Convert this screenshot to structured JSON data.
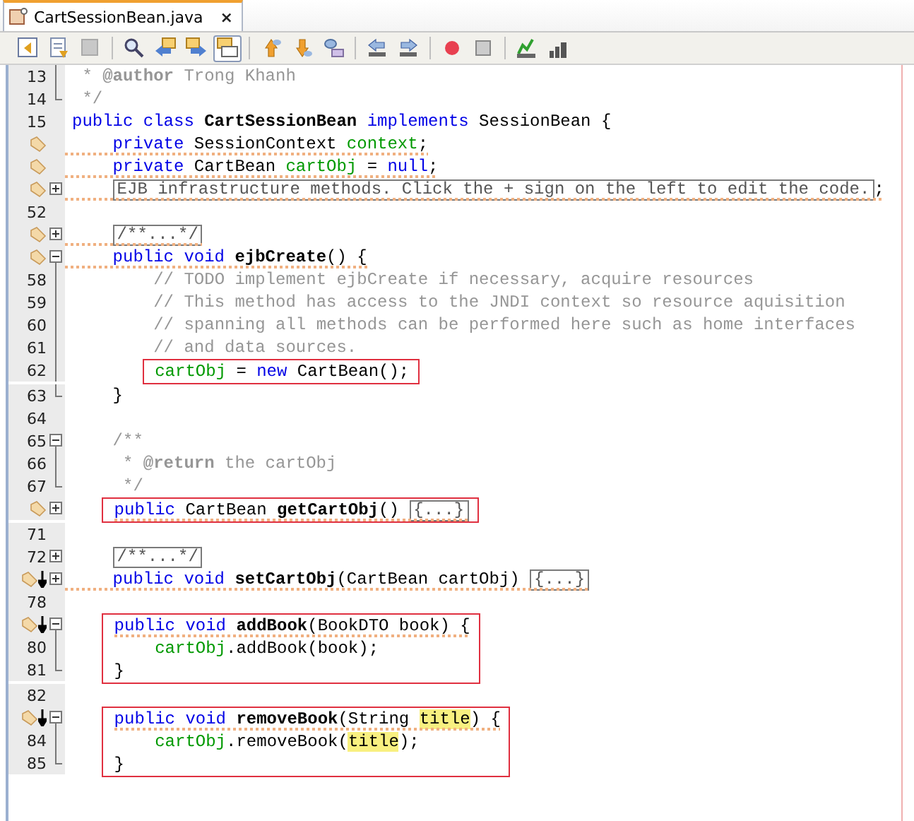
{
  "tab": {
    "title": "CartSessionBean.java",
    "close": "×",
    "selected": true
  },
  "toolbar": [
    {
      "kind": "history",
      "selected": false
    },
    {
      "kind": "doc-menu",
      "selected": false
    },
    {
      "kind": "disabled-menu",
      "selected": false
    },
    {
      "kind": "sep"
    },
    {
      "kind": "find",
      "selected": false
    },
    {
      "kind": "find-prev",
      "selected": false
    },
    {
      "kind": "find-next",
      "selected": false
    },
    {
      "kind": "highlight",
      "selected": true
    },
    {
      "kind": "sep"
    },
    {
      "kind": "up",
      "selected": false
    },
    {
      "kind": "down",
      "selected": false
    },
    {
      "kind": "toggle",
      "selected": false
    },
    {
      "kind": "sep"
    },
    {
      "kind": "shift-left",
      "selected": false
    },
    {
      "kind": "shift-right",
      "selected": false
    },
    {
      "kind": "sep"
    },
    {
      "kind": "record",
      "selected": false
    },
    {
      "kind": "stop",
      "selected": false
    },
    {
      "kind": "sep"
    },
    {
      "kind": "check",
      "selected": false
    },
    {
      "kind": "bars",
      "selected": false
    }
  ],
  "rows": [
    {
      "kind": "doc",
      "number": "13",
      "fold": {
        "kind": "inner"
      },
      "warning": false,
      "tokens": [
        {
          "text": "*",
          "kind": "comment"
        },
        {
          "text": "@author",
          "kind": "tag"
        },
        {
          "text": "Trong Khanh",
          "kind": "comment"
        }
      ]
    },
    {
      "kind": "doc",
      "number": "14",
      "fold": {
        "kind": "end"
      },
      "warning": false,
      "tokens": [
        {
          "text": "*/",
          "kind": "comment"
        }
      ]
    },
    {
      "kind": "code",
      "number": "15",
      "warning": false,
      "tokens": [
        {
          "text": "public class",
          "kind": "kw"
        },
        {
          "text": "CartSessionBean",
          "kind": "name"
        },
        {
          "text": "implements",
          "kind": "kw"
        },
        {
          "text": "SessionBean {",
          "kind": "plain"
        }
      ],
      "children": [
        {
          "kind": "code",
          "marks": [
            {
              "kind": "tag"
            }
          ],
          "warning": true,
          "tokens": [
            {
              "text": "private",
              "kind": "kw"
            },
            {
              "text": "SessionContext",
              "kind": "plain"
            },
            {
              "text": "context",
              "kind": "field"
            },
            {
              "text": ";",
              "kind": "punct"
            }
          ]
        },
        {
          "kind": "code",
          "marks": [
            {
              "kind": "tag"
            }
          ],
          "warning": true,
          "tokens": [
            {
              "text": "private",
              "kind": "kw"
            },
            {
              "text": "CartBean",
              "kind": "plain"
            },
            {
              "text": "cartObj",
              "kind": "field"
            },
            {
              "text": "=",
              "kind": "plain"
            },
            {
              "text": "null",
              "kind": "kw"
            },
            {
              "text": ";",
              "kind": "punct"
            }
          ]
        },
        {
          "kind": "code",
          "marks": [
            {
              "kind": "tag"
            }
          ],
          "fold": {
            "kind": "plus"
          },
          "warning": true,
          "tokens": [
            {
              "text": "EJB infrastructure methods. Click the + sign on the left to edit the code.",
              "kind": "folded"
            },
            {
              "text": ";",
              "kind": "punct"
            }
          ]
        },
        {
          "kind": "code",
          "number": "52",
          "warning": false
        },
        {
          "kind": "code",
          "marks": [
            {
              "kind": "tag"
            }
          ],
          "fold": {
            "kind": "plus"
          },
          "warning": true,
          "tokens": [
            {
              "text": "/**...*/",
              "kind": "folded"
            }
          ]
        },
        {
          "kind": "code",
          "marks": [
            {
              "kind": "tag"
            }
          ],
          "fold": {
            "kind": "minus"
          },
          "warning": true,
          "tokens": [
            {
              "text": "public void",
              "kind": "kw"
            },
            {
              "text": "ejbCreate",
              "kind": "name"
            },
            {
              "text": "() {",
              "kind": "punct"
            }
          ],
          "children": [
            {
              "kind": "code",
              "number": "58",
              "fold": {
                "kind": "inner"
              },
              "warning": false,
              "tokens": [
                {
                  "text": "// TODO implement ejbCreate if necessary, acquire resources",
                  "kind": "comment"
                }
              ]
            },
            {
              "kind": "code",
              "number": "59",
              "fold": {
                "kind": "inner"
              },
              "warning": false,
              "tokens": [
                {
                  "text": "// This method has access to the JNDI context so resource aquisition",
                  "kind": "comment"
                }
              ]
            },
            {
              "kind": "code",
              "number": "60",
              "fold": {
                "kind": "inner"
              },
              "warning": false,
              "tokens": [
                {
                  "text": "// spanning all methods can be performed here such as home interfaces",
                  "kind": "comment"
                }
              ]
            },
            {
              "kind": "code",
              "number": "61",
              "fold": {
                "kind": "inner"
              },
              "warning": false,
              "tokens": [
                {
                  "text": "// and data sources.",
                  "kind": "comment"
                }
              ]
            },
            {
              "kind": "boxed",
              "lines": [
                {
                  "number": "62",
                  "fold": {
                    "kind": "inner"
                  },
                  "warning": false,
                  "tokens": [
                    {
                      "text": "cartObj",
                      "kind": "field"
                    },
                    {
                      "text": "=",
                      "kind": "plain"
                    },
                    {
                      "text": "new",
                      "kind": "kw"
                    },
                    {
                      "text": "CartBean();",
                      "kind": "plain"
                    }
                  ]
                }
              ]
            }
          ]
        },
        {
          "kind": "code",
          "number": "63",
          "fold": {
            "kind": "end"
          },
          "warning": false,
          "tokens": [
            {
              "text": "}",
              "kind": "punct"
            }
          ]
        },
        {
          "kind": "code",
          "number": "64",
          "warning": false
        },
        {
          "kind": "code",
          "number": "65",
          "fold": {
            "kind": "minus"
          },
          "warning": false,
          "tokens": [
            {
              "text": "/**",
              "kind": "comment"
            }
          ]
        },
        {
          "kind": "doc",
          "number": "66",
          "fold": {
            "kind": "inner"
          },
          "warning": false,
          "tokens": [
            {
              "text": "*",
              "kind": "comment"
            },
            {
              "text": "@return",
              "kind": "tag"
            },
            {
              "text": "the cartObj",
              "kind": "comment"
            }
          ]
        },
        {
          "kind": "doc",
          "number": "67",
          "fold": {
            "kind": "end"
          },
          "warning": false,
          "tokens": [
            {
              "text": "*/",
              "kind": "comment"
            }
          ]
        },
        {
          "kind": "boxed",
          "lines": [
            {
              "marks": [
                {
                  "kind": "tag"
                }
              ],
              "fold": {
                "kind": "plus"
              },
              "warning": true,
              "tokens": [
                {
                  "text": "public",
                  "kind": "kw"
                },
                {
                  "text": "CartBean",
                  "kind": "plain"
                },
                {
                  "text": "getCartObj",
                  "kind": "name"
                },
                {
                  "text": "()",
                  "kind": "punct"
                },
                {
                  "text": "{...}",
                  "kind": "folded"
                }
              ]
            }
          ]
        },
        {
          "kind": "code",
          "number": "71",
          "warning": false
        },
        {
          "kind": "code",
          "number": "72",
          "fold": {
            "kind": "plus"
          },
          "warning": false,
          "tokens": [
            {
              "text": "/**...*/",
              "kind": "folded"
            }
          ]
        },
        {
          "kind": "code",
          "marks": [
            {
              "kind": "tag"
            },
            {
              "kind": "arrow"
            }
          ],
          "fold": {
            "kind": "plus"
          },
          "warning": true,
          "tokens": [
            {
              "text": "public void",
              "kind": "kw"
            },
            {
              "text": "setCartObj",
              "kind": "name"
            },
            {
              "text": "(CartBean cartObj)",
              "kind": "punct"
            },
            {
              "text": "{...}",
              "kind": "folded"
            }
          ]
        },
        {
          "kind": "code",
          "number": "78",
          "warning": false
        },
        {
          "kind": "boxed",
          "lines": [
            {
              "marks": [
                {
                  "kind": "tag"
                },
                {
                  "kind": "arrow"
                }
              ],
              "fold": {
                "kind": "minus"
              },
              "warning": true,
              "tokens": [
                {
                  "text": "public void",
                  "kind": "kw"
                },
                {
                  "text": "addBook",
                  "kind": "name"
                },
                {
                  "text": "(BookDTO book) {",
                  "kind": "punct"
                }
              ],
              "children": [
                {
                  "number": "80",
                  "fold": {
                    "kind": "inner"
                  },
                  "warning": false,
                  "tokens": [
                    {
                      "text": "cartObj",
                      "kind": "field"
                    },
                    {
                      "text": ".addBook(book);",
                      "kind": "punct"
                    }
                  ]
                }
              ]
            },
            {
              "number": "81",
              "fold": {
                "kind": "end"
              },
              "warning": false,
              "tokens": [
                {
                  "text": "}",
                  "kind": "punct"
                }
              ]
            }
          ]
        },
        {
          "kind": "code",
          "number": "82",
          "warning": false
        },
        {
          "kind": "boxed",
          "lines": [
            {
              "marks": [
                {
                  "kind": "tag"
                },
                {
                  "kind": "arrow"
                }
              ],
              "fold": {
                "kind": "minus"
              },
              "warning": true,
              "tokens": [
                {
                  "text": "public void",
                  "kind": "kw"
                },
                {
                  "text": "removeBook",
                  "kind": "name"
                },
                {
                  "text": "(String",
                  "kind": "punct"
                },
                {
                  "text": "title",
                  "kind": "hl"
                },
                {
                  "text": ") {",
                  "kind": "punct"
                }
              ],
              "children": [
                {
                  "number": "84",
                  "fold": {
                    "kind": "inner"
                  },
                  "warning": false,
                  "tokens": [
                    {
                      "text": "cartObj",
                      "kind": "field"
                    },
                    {
                      "text": ".removeBook(",
                      "kind": "punct"
                    },
                    {
                      "text": "title",
                      "kind": "hl-joined"
                    },
                    {
                      "text": ");",
                      "kind": "punct"
                    }
                  ]
                }
              ]
            },
            {
              "number": "85",
              "fold": {
                "kind": "end"
              },
              "warning": false,
              "tokens": [
                {
                  "text": "}",
                  "kind": "punct"
                }
              ]
            }
          ]
        }
      ]
    }
  ]
}
